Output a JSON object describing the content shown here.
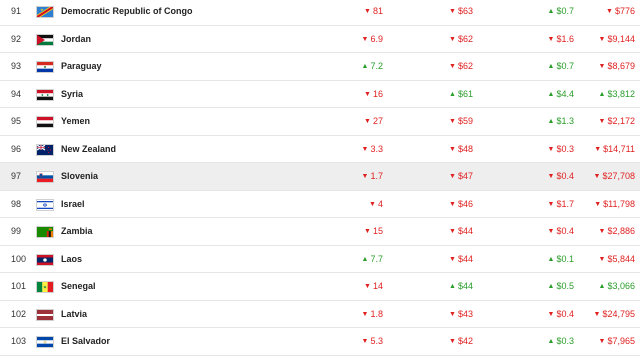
{
  "rows": [
    {
      "rank": "91",
      "country": "Democratic Republic of Congo",
      "flag": "drc-flag-icon",
      "c1": {
        "dir": "down",
        "text": "81"
      },
      "c2": {
        "dir": "down",
        "text": "$63"
      },
      "c3": {
        "dir": "up",
        "text": "$0.7"
      },
      "c4": {
        "dir": "down",
        "text": "$776"
      }
    },
    {
      "rank": "92",
      "country": "Jordan",
      "flag": "jordan-flag-icon",
      "c1": {
        "dir": "down",
        "text": "6.9"
      },
      "c2": {
        "dir": "down",
        "text": "$62"
      },
      "c3": {
        "dir": "down",
        "text": "$1.6"
      },
      "c4": {
        "dir": "down",
        "text": "$9,144"
      }
    },
    {
      "rank": "93",
      "country": "Paraguay",
      "flag": "paraguay-flag-icon",
      "c1": {
        "dir": "up",
        "text": "7.2"
      },
      "c2": {
        "dir": "down",
        "text": "$62"
      },
      "c3": {
        "dir": "up",
        "text": "$0.7"
      },
      "c4": {
        "dir": "down",
        "text": "$8,679"
      }
    },
    {
      "rank": "94",
      "country": "Syria",
      "flag": "syria-flag-icon",
      "c1": {
        "dir": "down",
        "text": "16"
      },
      "c2": {
        "dir": "up",
        "text": "$61"
      },
      "c3": {
        "dir": "up",
        "text": "$4.4"
      },
      "c4": {
        "dir": "up",
        "text": "$3,812"
      }
    },
    {
      "rank": "95",
      "country": "Yemen",
      "flag": "yemen-flag-icon",
      "c1": {
        "dir": "down",
        "text": "27"
      },
      "c2": {
        "dir": "down",
        "text": "$59"
      },
      "c3": {
        "dir": "up",
        "text": "$1.3"
      },
      "c4": {
        "dir": "down",
        "text": "$2,172"
      }
    },
    {
      "rank": "96",
      "country": "New Zealand",
      "flag": "new-zealand-flag-icon",
      "c1": {
        "dir": "down",
        "text": "3.3"
      },
      "c2": {
        "dir": "down",
        "text": "$48"
      },
      "c3": {
        "dir": "down",
        "text": "$0.3"
      },
      "c4": {
        "dir": "down",
        "text": "$14,711"
      }
    },
    {
      "rank": "97",
      "country": "Slovenia",
      "flag": "slovenia-flag-icon",
      "highlight": true,
      "c1": {
        "dir": "down",
        "text": "1.7"
      },
      "c2": {
        "dir": "down",
        "text": "$47"
      },
      "c3": {
        "dir": "down",
        "text": "$0.4"
      },
      "c4": {
        "dir": "down",
        "text": "$27,708"
      }
    },
    {
      "rank": "98",
      "country": "Israel",
      "flag": "israel-flag-icon",
      "c1": {
        "dir": "down",
        "text": "4"
      },
      "c2": {
        "dir": "down",
        "text": "$46"
      },
      "c3": {
        "dir": "down",
        "text": "$1.7"
      },
      "c4": {
        "dir": "down",
        "text": "$11,798"
      }
    },
    {
      "rank": "99",
      "country": "Zambia",
      "flag": "zambia-flag-icon",
      "c1": {
        "dir": "down",
        "text": "15"
      },
      "c2": {
        "dir": "down",
        "text": "$44"
      },
      "c3": {
        "dir": "down",
        "text": "$0.4"
      },
      "c4": {
        "dir": "down",
        "text": "$2,886"
      }
    },
    {
      "rank": "100",
      "country": "Laos",
      "flag": "laos-flag-icon",
      "c1": {
        "dir": "up",
        "text": "7.7"
      },
      "c2": {
        "dir": "down",
        "text": "$44"
      },
      "c3": {
        "dir": "up",
        "text": "$0.1"
      },
      "c4": {
        "dir": "down",
        "text": "$5,844"
      }
    },
    {
      "rank": "101",
      "country": "Senegal",
      "flag": "senegal-flag-icon",
      "c1": {
        "dir": "down",
        "text": "14"
      },
      "c2": {
        "dir": "up",
        "text": "$44"
      },
      "c3": {
        "dir": "up",
        "text": "$0.5"
      },
      "c4": {
        "dir": "up",
        "text": "$3,066"
      }
    },
    {
      "rank": "102",
      "country": "Latvia",
      "flag": "latvia-flag-icon",
      "c1": {
        "dir": "down",
        "text": "1.8"
      },
      "c2": {
        "dir": "down",
        "text": "$43"
      },
      "c3": {
        "dir": "down",
        "text": "$0.4"
      },
      "c4": {
        "dir": "down",
        "text": "$24,795"
      }
    },
    {
      "rank": "103",
      "country": "El Salvador",
      "flag": "el-salvador-flag-icon",
      "c1": {
        "dir": "down",
        "text": "5.3"
      },
      "c2": {
        "dir": "down",
        "text": "$42"
      },
      "c3": {
        "dir": "up",
        "text": "$0.3"
      },
      "c4": {
        "dir": "down",
        "text": "$7,965"
      }
    }
  ],
  "colors": {
    "up": "#2a9d2a",
    "down": "#e02121",
    "highlight": "#eeeeee"
  }
}
